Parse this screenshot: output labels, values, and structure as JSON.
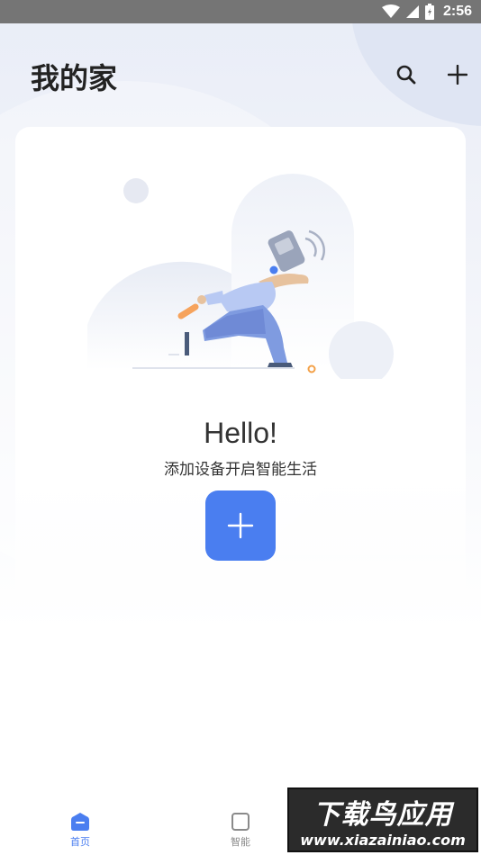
{
  "status_bar": {
    "time": "2:56",
    "icons": [
      "wifi-icon",
      "signal-icon",
      "battery-icon"
    ]
  },
  "header": {
    "title": "我的家",
    "icons": [
      "search-icon",
      "plus-icon"
    ]
  },
  "card": {
    "greeting": "Hello!",
    "subtitle": "添加设备开启智能生活",
    "add_icon": "plus-icon"
  },
  "bottom_nav": {
    "items": [
      {
        "label": "首页",
        "icon": "home-icon",
        "active": true
      },
      {
        "label": "智能",
        "icon": "smart-square-icon",
        "active": false
      }
    ]
  },
  "watermark": {
    "title": "下载鸟应用",
    "url": "www.xiazainiao.com"
  },
  "colors": {
    "accent": "#4a7ef0",
    "status_bar": "#757575",
    "inactive": "#8a8a8a"
  }
}
